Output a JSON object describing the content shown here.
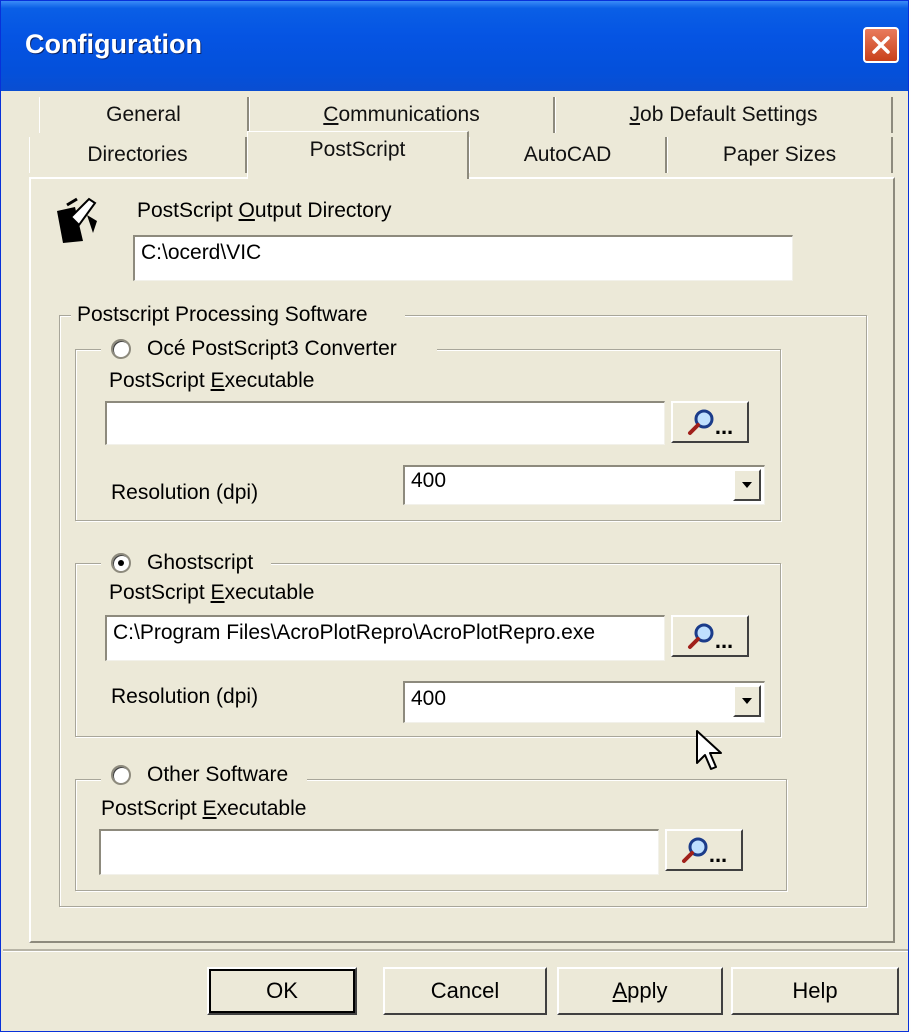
{
  "window": {
    "title": "Configuration"
  },
  "tabs": {
    "row1": [
      {
        "label": "General",
        "mnemonic": ""
      },
      {
        "label": "Communications",
        "mnemonic": "C"
      },
      {
        "label": "Job Default Settings",
        "mnemonic": "J"
      }
    ],
    "row2": [
      {
        "label": "Directories"
      },
      {
        "label": "PostScript",
        "selected": true
      },
      {
        "label": "AutoCAD"
      },
      {
        "label": "Paper Sizes"
      }
    ]
  },
  "output_dir": {
    "label_pre": "PostScript ",
    "label_mn": "O",
    "label_post": "utput Directory",
    "value": "C:\\ocerd\\VIC"
  },
  "processing": {
    "group_label": "Postscript Processing Software",
    "oce": {
      "radio_label": "Océ PostScript3 Converter",
      "selected": false,
      "exe_label_pre": "PostScript ",
      "exe_label_mn": "E",
      "exe_label_post": "xecutable",
      "exe_value": "",
      "resolution_label": "Resolution (dpi)",
      "resolution_value": "400",
      "browse_label": "..."
    },
    "ghostscript": {
      "radio_label": "Ghostscript",
      "selected": true,
      "exe_label_pre": "PostScript ",
      "exe_label_mn": "E",
      "exe_label_post": "xecutable",
      "exe_value": "C:\\Program Files\\AcroPlotRepro\\AcroPlotRepro.exe",
      "resolution_label": "Resolution (dpi)",
      "resolution_value": "400",
      "browse_label": "..."
    },
    "other": {
      "radio_label": "Other Software",
      "selected": false,
      "exe_label_pre": "PostScript ",
      "exe_label_mn": "E",
      "exe_label_post": "xecutable",
      "exe_value": "",
      "browse_label": "..."
    }
  },
  "buttons": {
    "ok": "OK",
    "cancel": "Cancel",
    "apply_mn": "A",
    "apply_rest": "pply",
    "help": "Help"
  },
  "colors": {
    "titlebar": "#0554e3",
    "dialog_bg": "#ece9d8",
    "close_button": "#d4512a"
  },
  "icons": [
    "close-icon",
    "printer-pen-icon",
    "magnifier-icon",
    "chevron-down-icon",
    "mouse-cursor-icon"
  ]
}
